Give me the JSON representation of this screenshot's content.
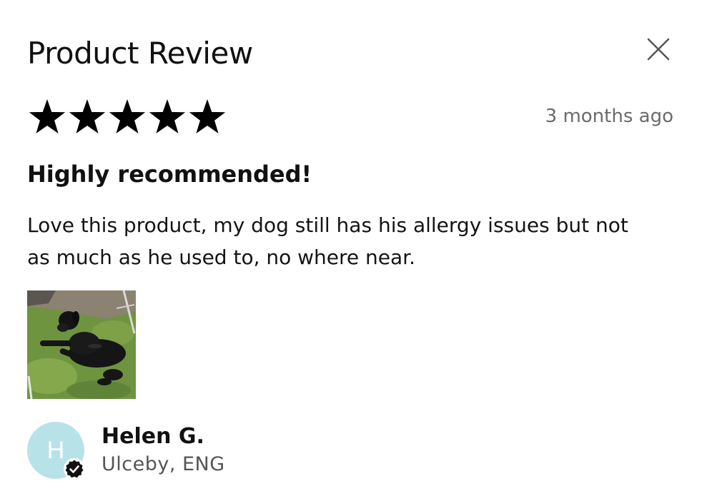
{
  "modal": {
    "title": "Product Review"
  },
  "review": {
    "rating": 5,
    "max_rating": 5,
    "date": "3 months ago",
    "heading": "Highly recommended!",
    "body": "Love this product, my dog still has his allergy issues but not as much as he used to, no where near."
  },
  "author": {
    "initial": "H",
    "name": "Helen G.",
    "location": "Ulceby, ENG",
    "verified": true
  },
  "colors": {
    "star": "#000000",
    "avatar_bg": "#b7e3e8",
    "date_text": "#6b6b6b",
    "location_text": "#555555"
  },
  "icons": {
    "close": "close-icon",
    "star": "star-icon",
    "verified": "verified-check-icon",
    "photo": "dog-photo"
  }
}
